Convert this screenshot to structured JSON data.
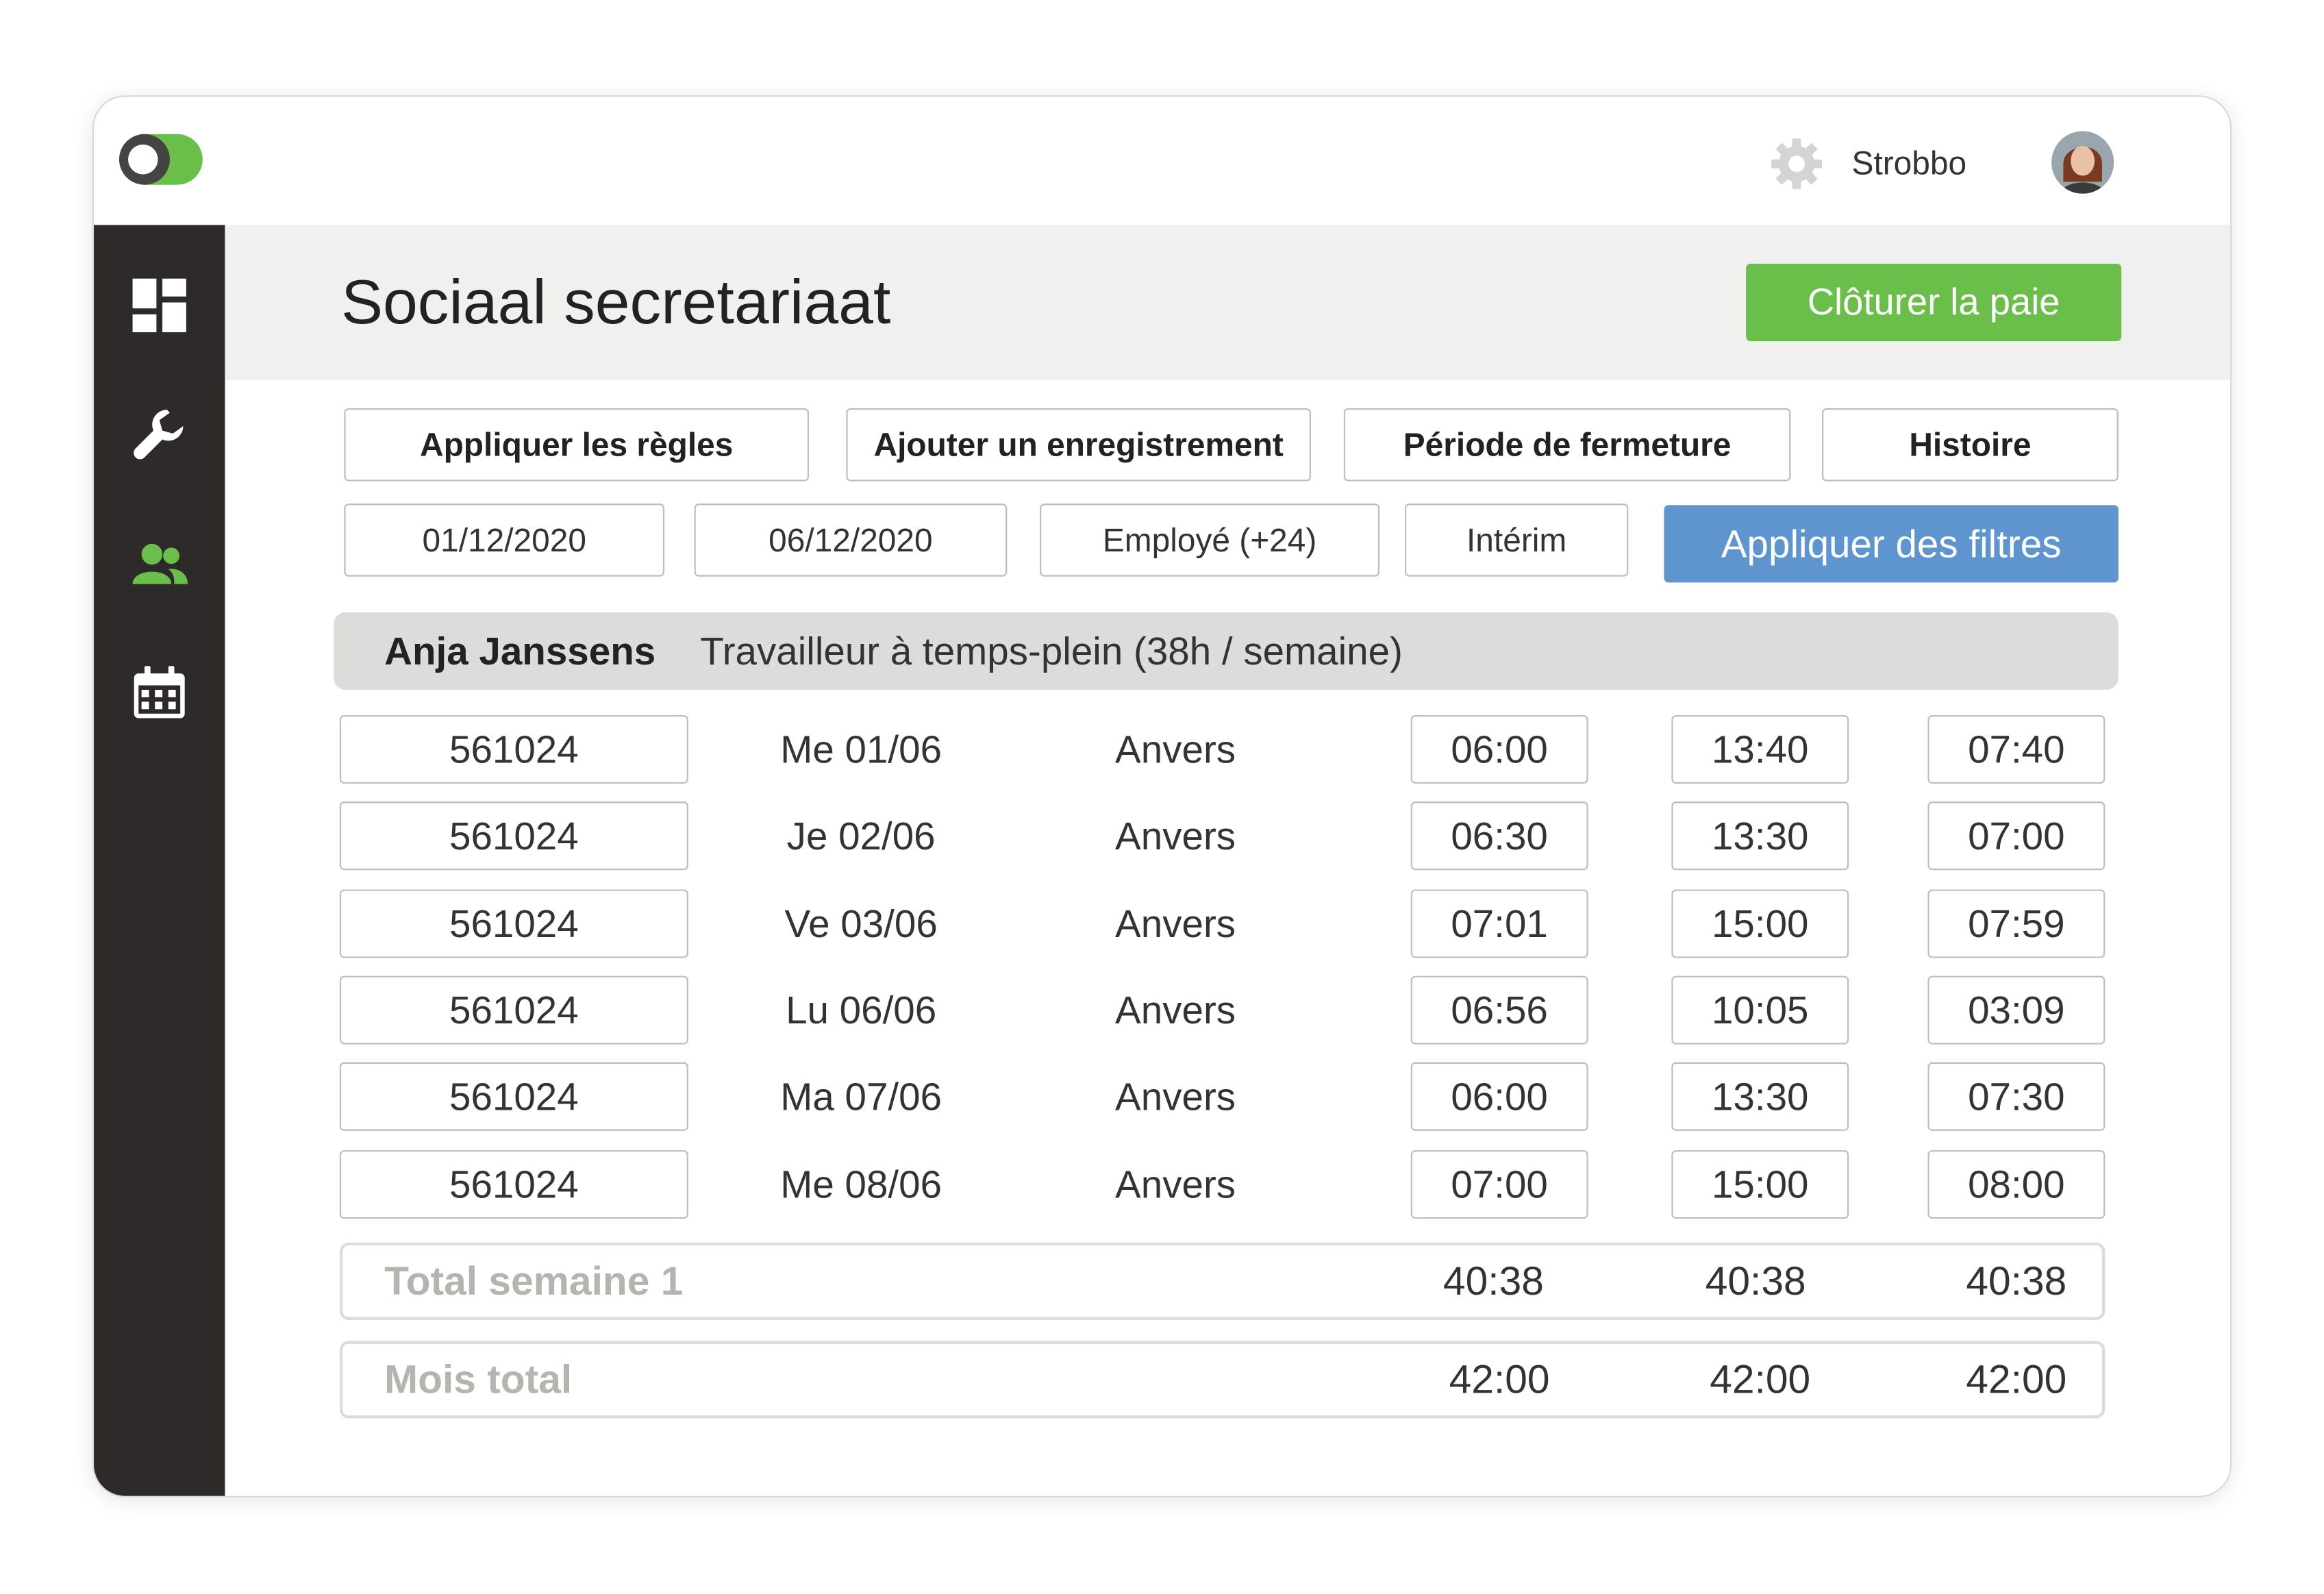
{
  "topbar": {
    "username": "Strobbo",
    "icons": {
      "settings": "gear-icon",
      "avatar": "avatar"
    }
  },
  "sidebar": {
    "items": [
      {
        "icon": "dashboard-icon"
      },
      {
        "icon": "wrench-icon"
      },
      {
        "icon": "users-icon",
        "active": true
      },
      {
        "icon": "calendar-icon"
      }
    ]
  },
  "header": {
    "title": "Sociaal secretariaat",
    "close_payroll_label": "Clôturer la paie"
  },
  "actions": {
    "apply_rules": "Appliquer les règles",
    "add_record": "Ajouter un enregistrement",
    "closing_period": "Période de fermeture",
    "history": "Histoire"
  },
  "filters": {
    "date_from": "01/12/2020",
    "date_to": "06/12/2020",
    "employee": "Employé (+24)",
    "contract": "Intérim",
    "apply_label": "Appliquer des filtres"
  },
  "employee": {
    "name": "Anja Janssens",
    "description": "Travailleur à temps-plein (38h / semaine)"
  },
  "rows": [
    {
      "code": "561024",
      "date": "Me 01/06",
      "location": "Anvers",
      "start": "06:00",
      "end": "13:40",
      "total": "07:40"
    },
    {
      "code": "561024",
      "date": "Je 02/06",
      "location": "Anvers",
      "start": "06:30",
      "end": "13:30",
      "total": "07:00"
    },
    {
      "code": "561024",
      "date": "Ve 03/06",
      "location": "Anvers",
      "start": "07:01",
      "end": "15:00",
      "total": "07:59"
    },
    {
      "code": "561024",
      "date": "Lu 06/06",
      "location": "Anvers",
      "start": "06:56",
      "end": "10:05",
      "total": "03:09"
    },
    {
      "code": "561024",
      "date": "Ma 07/06",
      "location": "Anvers",
      "start": "06:00",
      "end": "13:30",
      "total": "07:30"
    },
    {
      "code": "561024",
      "date": "Me 08/06",
      "location": "Anvers",
      "start": "07:00",
      "end": "15:00",
      "total": "08:00"
    }
  ],
  "totals": [
    {
      "label": "Total semaine 1",
      "values": [
        "40:38",
        "40:38",
        "40:38"
      ]
    },
    {
      "label": "Mois total",
      "values": [
        "42:00",
        "42:00",
        "42:00"
      ]
    }
  ],
  "colors": {
    "sidebar": "#2d2a29",
    "accent_green": "#6abf4b",
    "accent_blue": "#5f95cf",
    "header_band": "#f0f0ef",
    "employee_band": "#dcdcda"
  }
}
